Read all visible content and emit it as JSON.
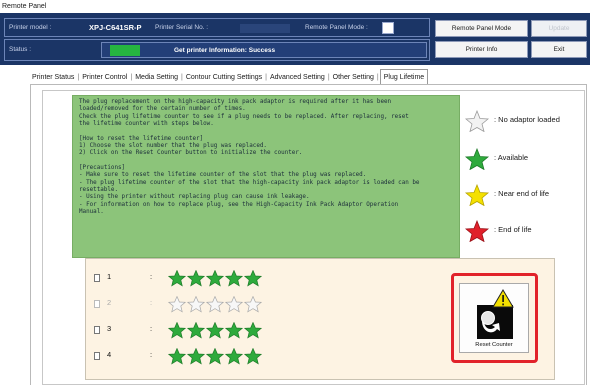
{
  "window": {
    "title": "Remote Panel"
  },
  "header": {
    "printer_model_label": "Printer model :",
    "printer_model_value": "XPJ-C641SR-P",
    "serial_label": "Printer Serial No. :",
    "remote_mode_label": "Remote Panel Mode :",
    "status_label": "Status :",
    "status_text": "Get printer Information: Success",
    "status_color": "#26b540",
    "buttons": {
      "remote_panel_mode": "Remote Panel Mode",
      "update": "Update",
      "printer_info": "Printer Info",
      "exit": "Exit"
    }
  },
  "tabs": [
    {
      "label": "Printer Status"
    },
    {
      "label": "Printer Control"
    },
    {
      "label": "Media Setting"
    },
    {
      "label": "Contour Cutting Settings"
    },
    {
      "label": "Advanced Setting"
    },
    {
      "label": "Other Setting"
    },
    {
      "label": "Plug Lifetime",
      "active": true
    }
  ],
  "info_text": "The plug replacement on the high-capacity ink pack adaptor is required after it has been\nloaded/removed for the certain number of times.\nCheck the plug lifetime counter to see if a plug needs to be replaced. After replacing, reset\nthe lifetime counter with steps below.\n\n[How to reset the lifetime counter]\n1) Choose the slot number that the plug was replaced.\n2) Click on the Reset Counter button to initialize the counter.\n\n[Precautions]\n- Make sure to reset the lifetime counter of the slot that the plug was replaced.\n- The plug lifetime counter of the slot that the high-capacity ink pack adaptor is loaded can be\nresettable.\n- Using the printer without replacing plug can cause ink leakage.\n- For information on how to replace plug, see the High-Capacity Ink Pack Adaptor Operation\nManual.",
  "legend": [
    {
      "label": ": No adaptor loaded",
      "icon": "white-star-icon",
      "color": "#f2f2f2"
    },
    {
      "label": ": Available",
      "icon": "green-star-icon",
      "color": "#2eaa3c"
    },
    {
      "label": ": Near end of life",
      "icon": "yellow-star-icon",
      "color": "#f4e000"
    },
    {
      "label": ": End of life",
      "icon": "red-star-icon",
      "color": "#e0202a"
    }
  ],
  "slots": [
    {
      "number": "1",
      "colon": ":",
      "enabled": true,
      "checked": false,
      "stars": [
        "green",
        "green",
        "green",
        "green",
        "green"
      ]
    },
    {
      "number": "2",
      "colon": ":",
      "enabled": false,
      "checked": false,
      "stars": [
        "white",
        "white",
        "white",
        "white",
        "white"
      ]
    },
    {
      "number": "3",
      "colon": ":",
      "enabled": true,
      "checked": false,
      "stars": [
        "green",
        "green",
        "green",
        "green",
        "green"
      ]
    },
    {
      "number": "4",
      "colon": ":",
      "enabled": true,
      "checked": false,
      "stars": [
        "green",
        "green",
        "green",
        "green",
        "green"
      ]
    }
  ],
  "reset_button": {
    "label": "Reset Counter",
    "icon": "reset-counter-icon"
  },
  "colors": {
    "header_bg": "#1b3566",
    "info_bg": "#8cc47a",
    "slot_panel_bg": "#fdf3e3",
    "highlight": "#e1222a"
  }
}
